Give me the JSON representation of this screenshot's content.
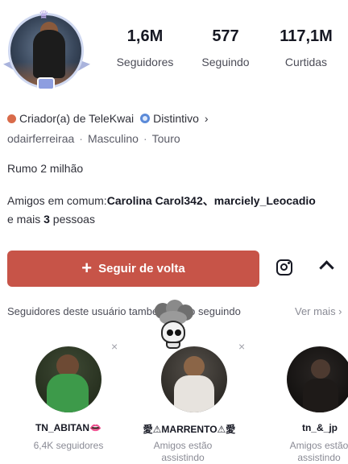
{
  "profile": {
    "stats": [
      {
        "value": "1,6M",
        "label": "Seguidores"
      },
      {
        "value": "577",
        "label": "Seguindo"
      },
      {
        "value": "117,1M",
        "label": "Curtidas"
      }
    ],
    "creator_label": "Criador(a) de TeleKwai",
    "distinct_label": "Distintivo",
    "distinct_chevron": "›",
    "username": "odairferreiraa",
    "gender": "Masculino",
    "sign": "Touro",
    "separator": "·",
    "bio": "Rumo 2 milhão",
    "mutual_prefix": "Amigos em comum:",
    "mutual_names": "Carolina Carol342、marciely_Leocadio",
    "mutual_suffix_pre": "e mais ",
    "mutual_count": "3",
    "mutual_suffix_post": " pessoas"
  },
  "actions": {
    "follow_back_label": "Seguir de volta",
    "follow_plus": "+",
    "instagram_icon": "instagram-icon",
    "collapse_icon": "chevron-up-icon"
  },
  "suggestions": {
    "title": "Seguidores deste usuário também estão seguindo",
    "see_more": "Ver mais ›",
    "close_glyph": "×",
    "cards": [
      {
        "name": "TN_ABITAN👄",
        "sub": "6,4K seguidores"
      },
      {
        "name": "愛⚠MARRENTO⚠愛",
        "sub": "Amigos estão assistindo"
      },
      {
        "name": "tn_&_jp",
        "sub": "Amigos estão assistindo"
      }
    ]
  },
  "colors": {
    "follow_button": "#c75448",
    "creator_dot": "#d96b4a",
    "distinct_icon": "#5b8ad8"
  }
}
